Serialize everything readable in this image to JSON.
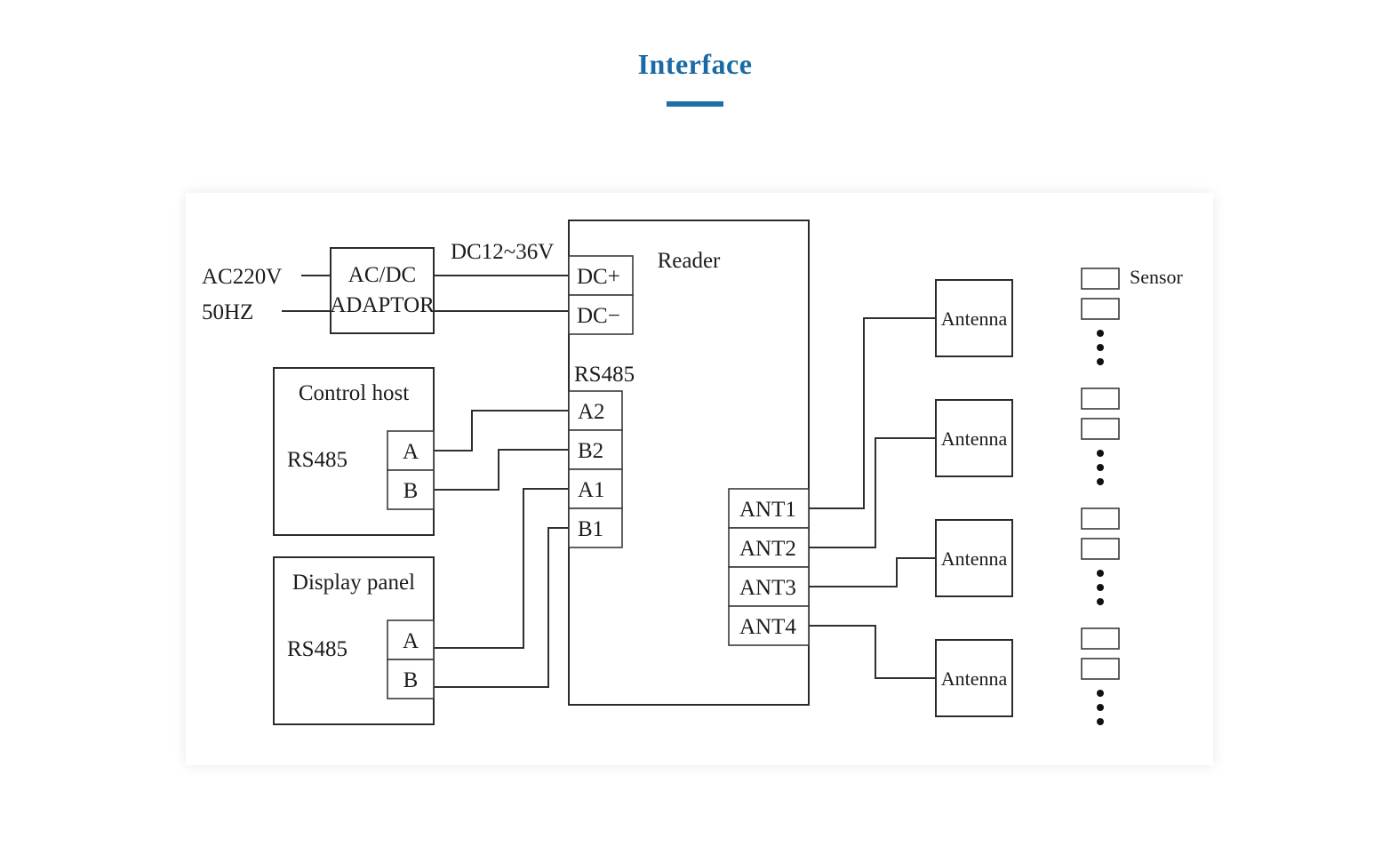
{
  "page": {
    "title": "Interface",
    "accent_color": "#1a6ba4",
    "rule_color": "#1f6fa8",
    "background": "#ffffff",
    "line_color": "#2f2f2f"
  },
  "diagram": {
    "type": "block-wiring-diagram",
    "power": {
      "source_line1": "AC220V",
      "source_line2": "50HZ",
      "adaptor_line1": "AC/DC",
      "adaptor_line2": "ADAPTOR",
      "output_label": "DC12~36V"
    },
    "reader": {
      "title": "Reader",
      "power_terminals": [
        "DC+",
        "DC−"
      ],
      "serial_bus_label": "RS485",
      "serial_terminals": [
        "A2",
        "B2",
        "A1",
        "B1"
      ],
      "antenna_terminals": [
        "ANT1",
        "ANT2",
        "ANT3",
        "ANT4"
      ]
    },
    "control_host": {
      "title": "Control host",
      "bus_label": "RS485",
      "terminals": [
        "A",
        "B"
      ]
    },
    "display_panel": {
      "title": "Display panel",
      "bus_label": "RS485",
      "terminals": [
        "A",
        "B"
      ]
    },
    "antennas": [
      {
        "label": "Antenna"
      },
      {
        "label": "Antenna"
      },
      {
        "label": "Antenna"
      },
      {
        "label": "Antenna"
      }
    ],
    "sensors": {
      "label": "Sensor",
      "group_count": 4,
      "boxes_per_group": 2,
      "dots_per_group": 3
    },
    "connections": [
      {
        "from": "AC220V",
        "to": "AC/DC ADAPTOR"
      },
      {
        "from": "50HZ",
        "to": "AC/DC ADAPTOR"
      },
      {
        "from": "AC/DC ADAPTOR",
        "to": "DC+"
      },
      {
        "from": "AC/DC ADAPTOR",
        "to": "DC−"
      },
      {
        "from": "Control host A",
        "to": "A2"
      },
      {
        "from": "Control host B",
        "to": "B2"
      },
      {
        "from": "Display panel A",
        "to": "A1"
      },
      {
        "from": "Display panel B",
        "to": "B1"
      },
      {
        "from": "ANT1",
        "to": "Antenna 1"
      },
      {
        "from": "ANT2",
        "to": "Antenna 2"
      },
      {
        "from": "ANT3",
        "to": "Antenna 3"
      },
      {
        "from": "ANT4",
        "to": "Antenna 4"
      }
    ]
  }
}
